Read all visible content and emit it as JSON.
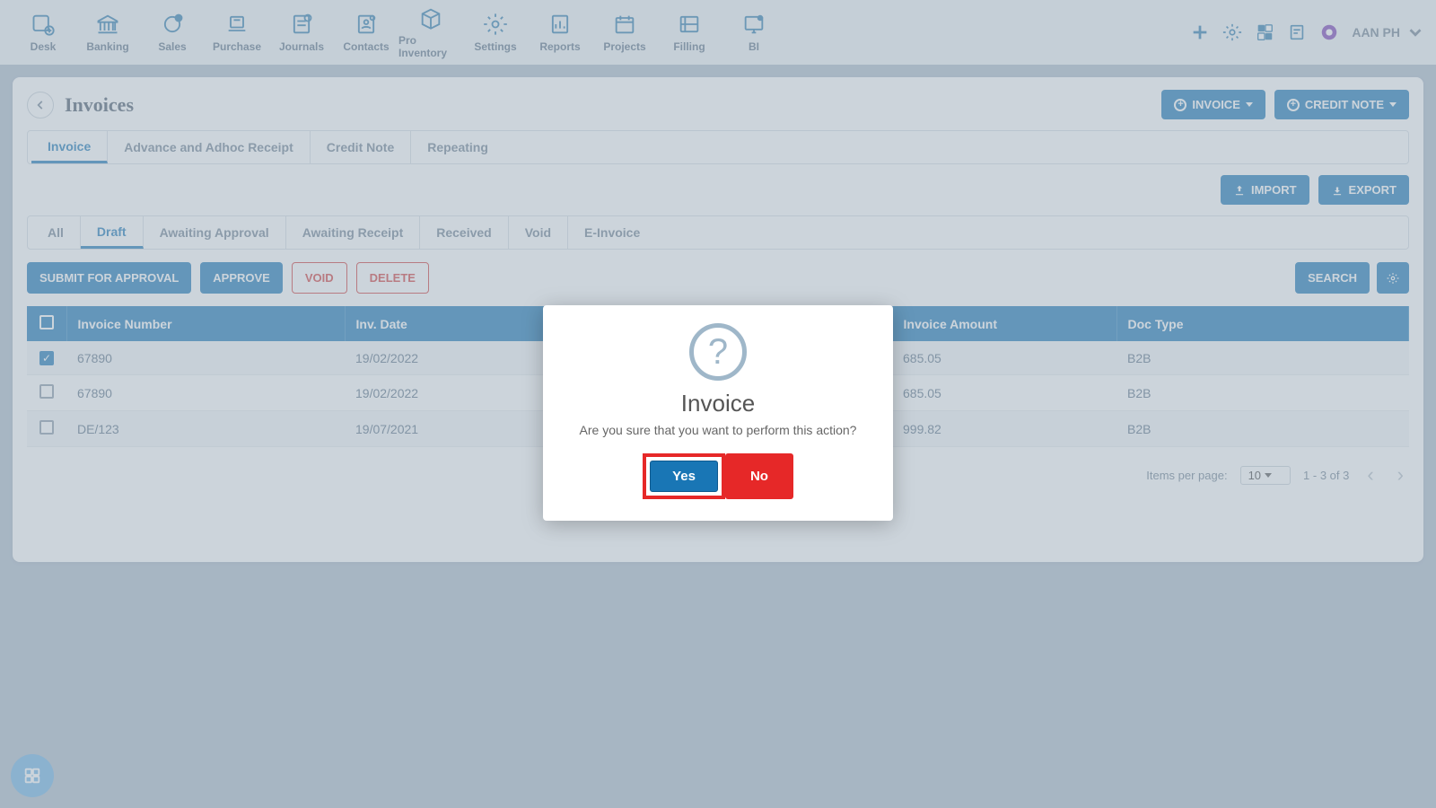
{
  "topnav": [
    {
      "label": "Desk"
    },
    {
      "label": "Banking"
    },
    {
      "label": "Sales"
    },
    {
      "label": "Purchase"
    },
    {
      "label": "Journals"
    },
    {
      "label": "Contacts"
    },
    {
      "label": "Pro Inventory"
    },
    {
      "label": "Settings"
    },
    {
      "label": "Reports"
    },
    {
      "label": "Projects"
    },
    {
      "label": "Filling"
    },
    {
      "label": "BI"
    }
  ],
  "user": {
    "name": "AAN PH"
  },
  "page": {
    "title": "Invoices",
    "invoice_btn": "INVOICE",
    "credit_note_btn": "CREDIT NOTE",
    "import_btn": "IMPORT",
    "export_btn": "EXPORT"
  },
  "tabs1": [
    "Invoice",
    "Advance and Adhoc Receipt",
    "Credit Note",
    "Repeating"
  ],
  "tabs1_active": 0,
  "tabs2": [
    "All",
    "Draft",
    "Awaiting Approval",
    "Awaiting Receipt",
    "Received",
    "Void",
    "E-Invoice"
  ],
  "tabs2_active": 1,
  "actions": {
    "submit": "SUBMIT FOR APPROVAL",
    "approve": "APPROVE",
    "void": "VOID",
    "delete": "DELETE",
    "search": "SEARCH"
  },
  "table": {
    "headers": [
      "Invoice Number",
      "Inv. Date",
      "",
      "Invoice Amount",
      "Doc Type"
    ],
    "rows": [
      {
        "checked": true,
        "num": "67890",
        "date": "19/02/2022",
        "amount": "685.05",
        "doc": "B2B"
      },
      {
        "checked": false,
        "num": "67890",
        "date": "19/02/2022",
        "amount": "685.05",
        "doc": "B2B"
      },
      {
        "checked": false,
        "num": "DE/123",
        "date": "19/07/2021",
        "amount": "999.82",
        "doc": "B2B"
      }
    ]
  },
  "pagination": {
    "items_label": "Items per page:",
    "per_page": "10",
    "range": "1 - 3 of 3"
  },
  "modal": {
    "title": "Invoice",
    "message": "Are you sure that you want to perform this action?",
    "yes": "Yes",
    "no": "No"
  }
}
